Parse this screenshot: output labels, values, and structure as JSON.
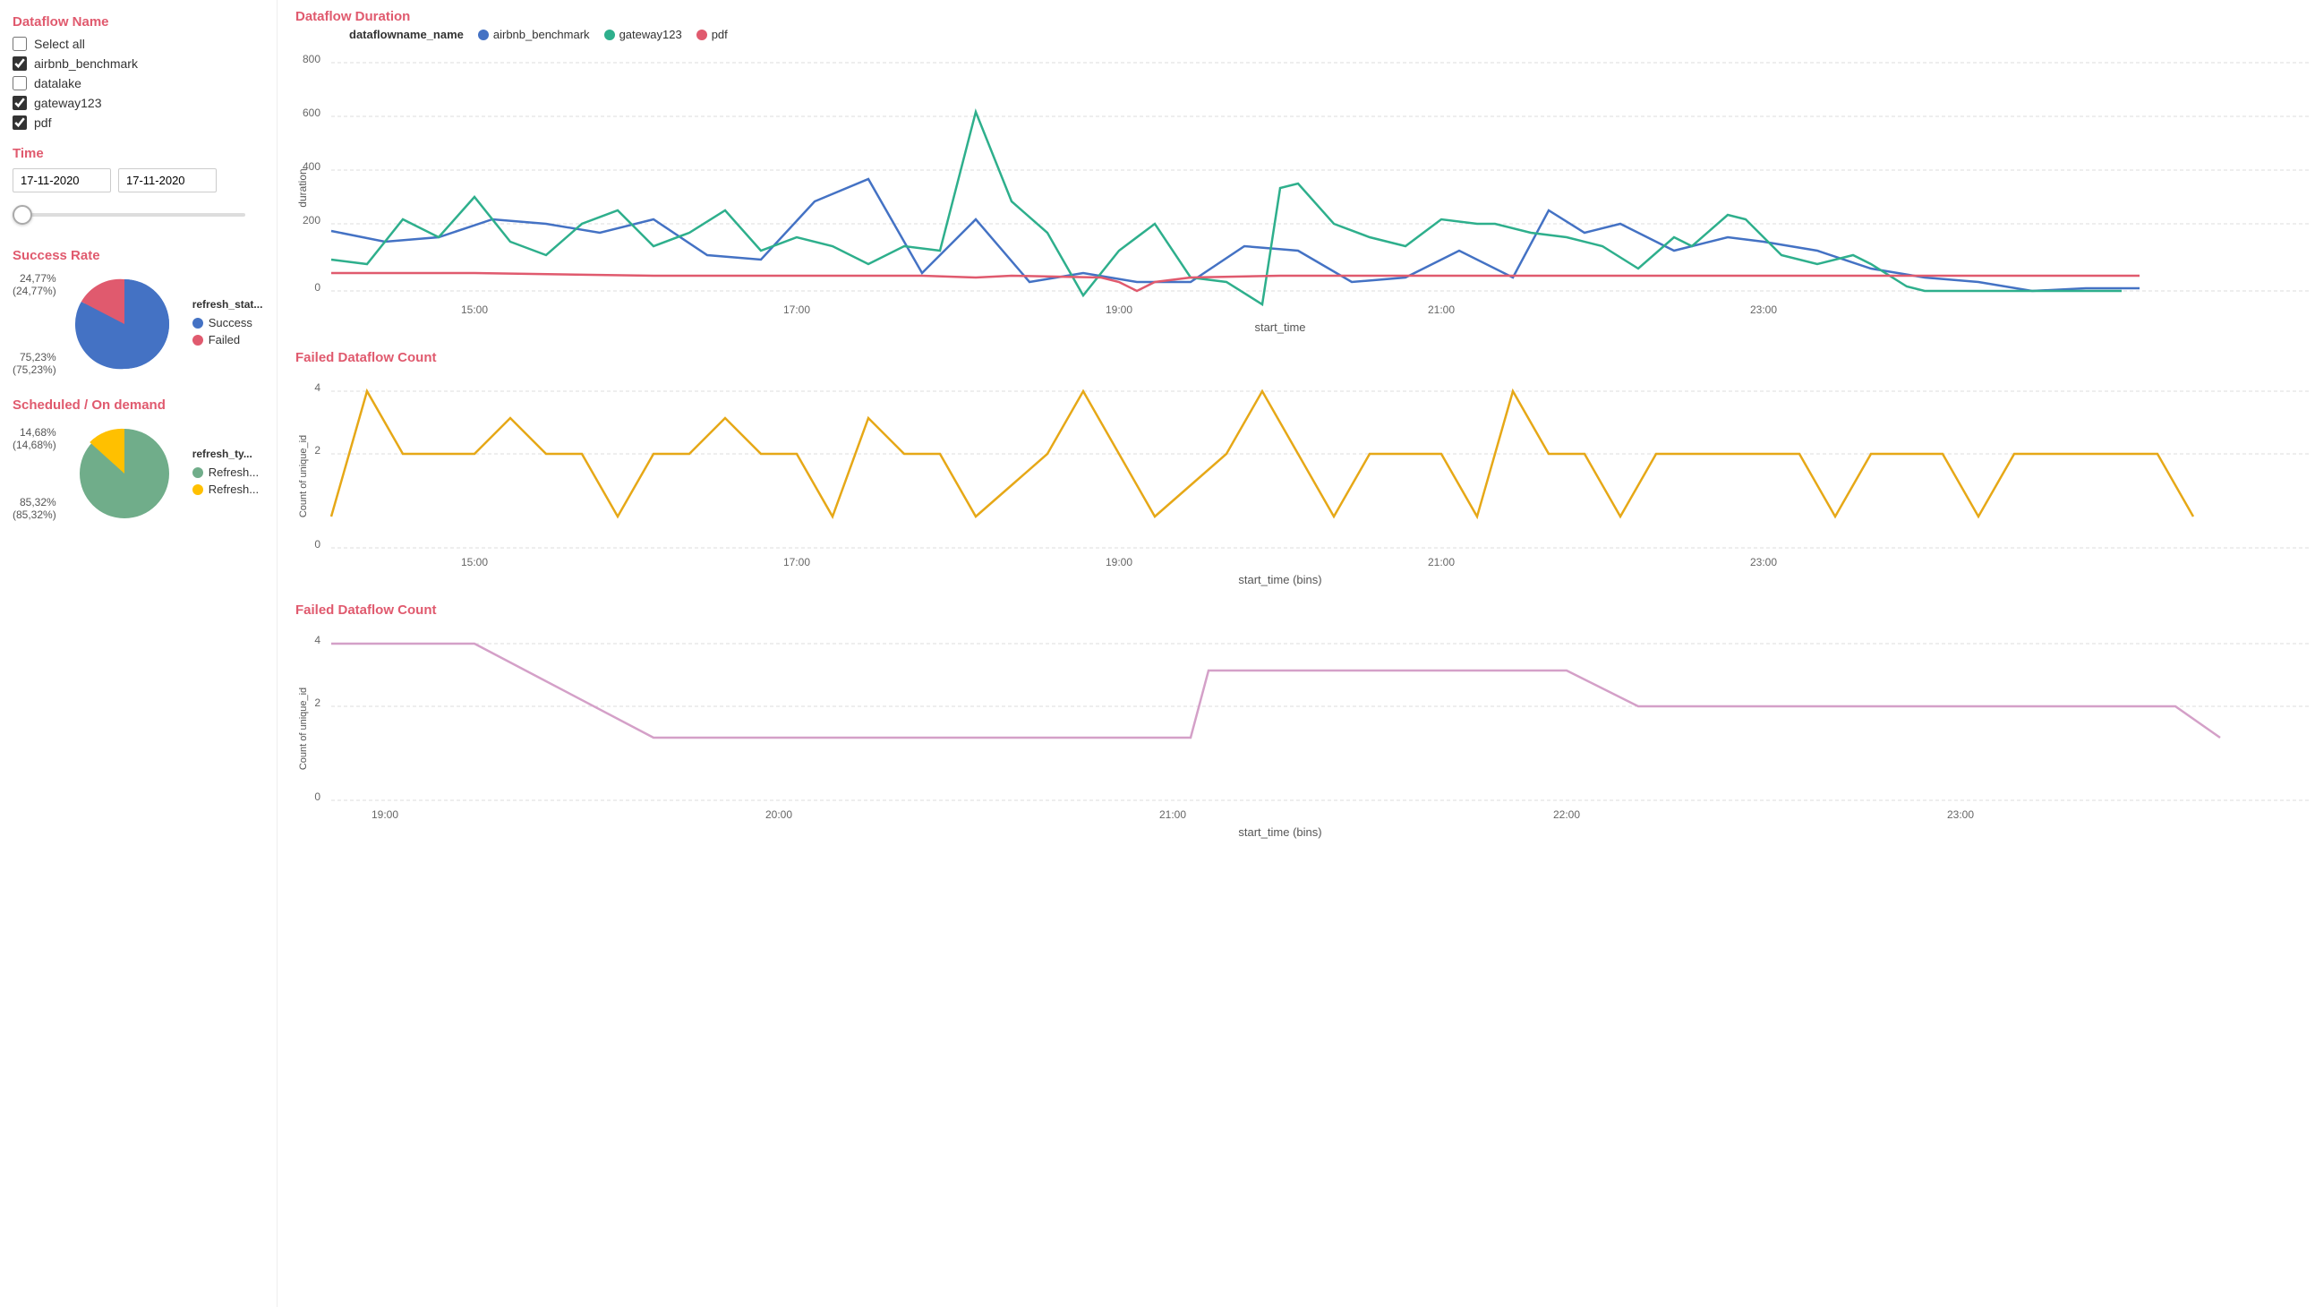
{
  "sidebar": {
    "dataflow_name_title": "Dataflow Name",
    "select_all_label": "Select all",
    "checkboxes": [
      {
        "id": "airbnb",
        "label": "airbnb_benchmark",
        "checked": true
      },
      {
        "id": "datalake",
        "label": "datalake",
        "checked": false
      },
      {
        "id": "gateway",
        "label": "gateway123",
        "checked": true
      },
      {
        "id": "pdf",
        "label": "pdf",
        "checked": true
      }
    ],
    "time_title": "Time",
    "date_from": "17-11-2020",
    "date_to": "17-11-2020",
    "success_rate_title": "Success Rate",
    "pie1": {
      "legend_title": "refresh_stat...",
      "segments": [
        {
          "label": "Success",
          "color": "#4472c4",
          "pct": 75.23,
          "pct_label": "75,23%",
          "pct_sub": "(75,23%)"
        },
        {
          "label": "Failed",
          "color": "#e05a6e",
          "pct": 24.77,
          "pct_label": "24,77%",
          "pct_sub": "(24,77%)"
        }
      ]
    },
    "scheduled_title": "Scheduled / On demand",
    "pie2": {
      "legend_title": "refresh_ty...",
      "segments": [
        {
          "label": "Refresh...",
          "color": "#70ad8a",
          "pct": 85.32,
          "pct_label": "85,32%",
          "pct_sub": "(85,32%)"
        },
        {
          "label": "Refresh...",
          "color": "#ffc000",
          "pct": 14.68,
          "pct_label": "14,68%",
          "pct_sub": "(14,68%)"
        }
      ]
    }
  },
  "charts": {
    "duration_title": "Dataflow Duration",
    "duration_legend_label": "dataflowname_name",
    "duration_series": [
      {
        "name": "airbnb_benchmark",
        "color": "#4472c4"
      },
      {
        "name": "gateway123",
        "color": "#2eaf8c"
      },
      {
        "name": "pdf",
        "color": "#e05a6e"
      }
    ],
    "duration_x_label": "start_time",
    "duration_y_label": "duration",
    "failed_count_title": "Failed Dataflow Count",
    "failed_x_label": "start_time (bins)",
    "failed_y_label": "Count of unique_id",
    "failed_count2_title": "Failed Dataflow Count",
    "failed2_x_label": "start_time (bins)",
    "failed2_y_label": "Count of unique_id",
    "failed2_series_color": "#d4a0c8"
  }
}
